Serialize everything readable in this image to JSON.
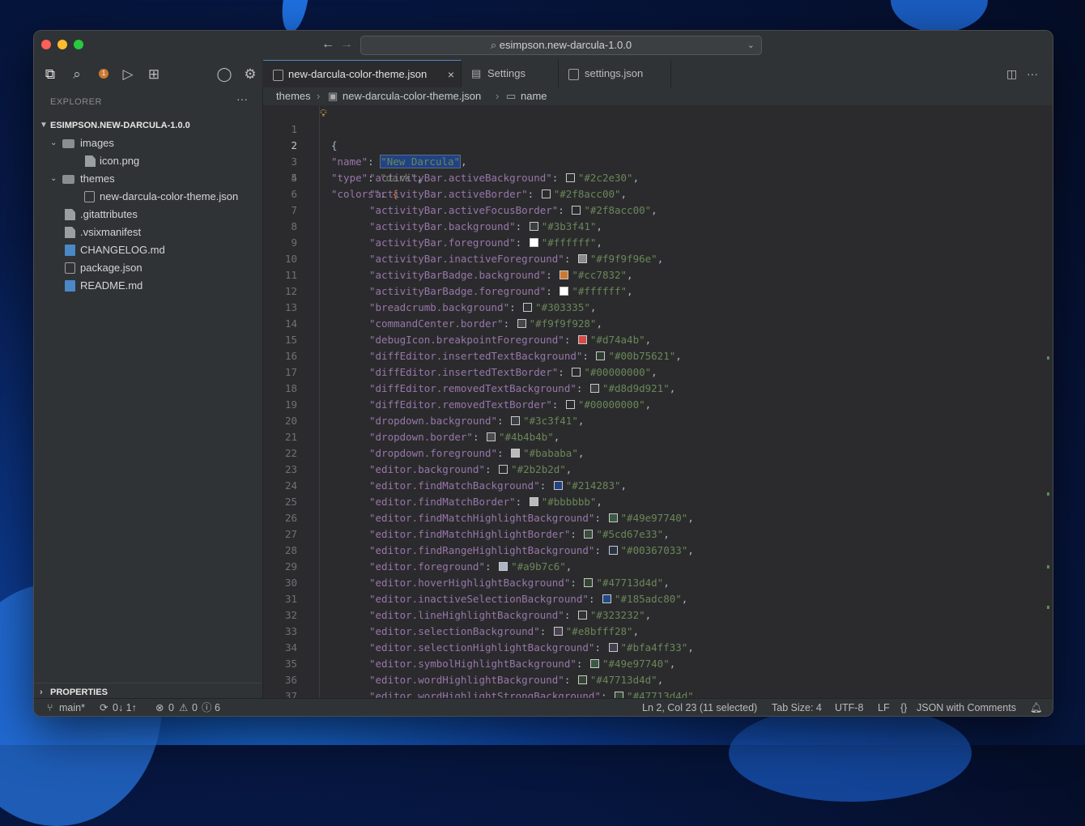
{
  "window": {
    "command_center": "esimpson.new-darcula-1.0.0"
  },
  "sidebar": {
    "title": "EXPLORER",
    "root": "ESIMPSON.NEW-DARCULA-1.0.0",
    "tree": [
      {
        "label": "images",
        "kind": "folder"
      },
      {
        "label": "icon.png",
        "kind": "file"
      },
      {
        "label": "themes",
        "kind": "folder"
      },
      {
        "label": "new-darcula-color-theme.json",
        "kind": "json"
      },
      {
        "label": ".gitattributes",
        "kind": "file"
      },
      {
        "label": ".vsixmanifest",
        "kind": "file"
      },
      {
        "label": "CHANGELOG.md",
        "kind": "md"
      },
      {
        "label": "package.json",
        "kind": "json"
      },
      {
        "label": "README.md",
        "kind": "md"
      }
    ],
    "properties": "PROPERTIES",
    "badge_count": "1"
  },
  "tabs": [
    {
      "label": "new-darcula-color-theme.json",
      "active": true
    },
    {
      "label": "Settings",
      "active": false
    },
    {
      "label": "settings.json",
      "active": false
    }
  ],
  "breadcrumb": [
    "themes",
    "new-darcula-color-theme.json",
    "name"
  ],
  "editor": {
    "header_lines": [
      {
        "n": "1",
        "text": "{"
      },
      {
        "n": "2",
        "key": "\"name\"",
        "value": "\"New Darcula\""
      },
      {
        "n": "3",
        "key": "\"type\"",
        "value": "\"dark\""
      },
      {
        "n": "4",
        "key": "\"colors\"",
        "value": "{"
      }
    ],
    "color_lines": [
      {
        "n": "5",
        "key": "\"activityBar.activeBackground\"",
        "value": "\"#2c2e30\"",
        "swatch": "#2c2e30"
      },
      {
        "n": "6",
        "key": "\"activityBar.activeBorder\"",
        "value": "\"#2f8acc00\"",
        "swatch": "#2b2b2d"
      },
      {
        "n": "7",
        "key": "\"activityBar.activeFocusBorder\"",
        "value": "\"#2f8acc00\"",
        "swatch": "#2b2b2d"
      },
      {
        "n": "8",
        "key": "\"activityBar.background\"",
        "value": "\"#3b3f41\"",
        "swatch": "#3b3f41"
      },
      {
        "n": "9",
        "key": "\"activityBar.foreground\"",
        "value": "\"#ffffff\"",
        "swatch": "#ffffff"
      },
      {
        "n": "10",
        "key": "\"activityBar.inactiveForeground\"",
        "value": "\"#f9f9f96e\"",
        "swatch": "#8a8a8a"
      },
      {
        "n": "11",
        "key": "\"activityBarBadge.background\"",
        "value": "\"#cc7832\"",
        "swatch": "#cc7832"
      },
      {
        "n": "12",
        "key": "\"activityBarBadge.foreground\"",
        "value": "\"#ffffff\"",
        "swatch": "#ffffff"
      },
      {
        "n": "13",
        "key": "\"breadcrumb.background\"",
        "value": "\"#303335\"",
        "swatch": "#303335"
      },
      {
        "n": "14",
        "key": "\"commandCenter.border\"",
        "value": "\"#f9f9f928\"",
        "swatch": "#45474a"
      },
      {
        "n": "15",
        "key": "\"debugIcon.breakpointForeground\"",
        "value": "\"#d74a4b\"",
        "swatch": "#d74a4b"
      },
      {
        "n": "16",
        "key": "\"diffEditor.insertedTextBackground\"",
        "value": "\"#00b75621\"",
        "swatch": "#2b3d31"
      },
      {
        "n": "17",
        "key": "\"diffEditor.insertedTextBorder\"",
        "value": "\"#00000000\"",
        "swatch": "#2b2b2d"
      },
      {
        "n": "18",
        "key": "\"diffEditor.removedTextBackground\"",
        "value": "\"#d8d9d921\"",
        "swatch": "#3d3e40"
      },
      {
        "n": "19",
        "key": "\"diffEditor.removedTextBorder\"",
        "value": "\"#00000000\"",
        "swatch": "#2b2b2d"
      },
      {
        "n": "20",
        "key": "\"dropdown.background\"",
        "value": "\"#3c3f41\"",
        "swatch": "#3c3f41"
      },
      {
        "n": "21",
        "key": "\"dropdown.border\"",
        "value": "\"#4b4b4b\"",
        "swatch": "#4b4b4b"
      },
      {
        "n": "22",
        "key": "\"dropdown.foreground\"",
        "value": "\"#bababa\"",
        "swatch": "#bababa"
      },
      {
        "n": "23",
        "key": "\"editor.background\"",
        "value": "\"#2b2b2d\"",
        "swatch": "#2b2b2d"
      },
      {
        "n": "24",
        "key": "\"editor.findMatchBackground\"",
        "value": "\"#214283\"",
        "swatch": "#214283"
      },
      {
        "n": "25",
        "key": "\"editor.findMatchBorder\"",
        "value": "\"#bbbbbb\"",
        "swatch": "#bbbbbb"
      },
      {
        "n": "26",
        "key": "\"editor.findMatchHighlightBackground\"",
        "value": "\"#49e97740\"",
        "swatch": "#3b5a43"
      },
      {
        "n": "27",
        "key": "\"editor.findMatchHighlightBorder\"",
        "value": "\"#5cd67e33\"",
        "swatch": "#3a4d3f"
      },
      {
        "n": "28",
        "key": "\"editor.findRangeHighlightBackground\"",
        "value": "\"#00367033\"",
        "swatch": "#283447"
      },
      {
        "n": "29",
        "key": "\"editor.foreground\"",
        "value": "\"#a9b7c6\"",
        "swatch": "#a9b7c6"
      },
      {
        "n": "30",
        "key": "\"editor.hoverHighlightBackground\"",
        "value": "\"#47713d4d\"",
        "swatch": "#334531"
      },
      {
        "n": "31",
        "key": "\"editor.inactiveSelectionBackground\"",
        "value": "\"#185adc80\"",
        "swatch": "#224a8a"
      },
      {
        "n": "32",
        "key": "\"editor.lineHighlightBackground\"",
        "value": "\"#323232\"",
        "swatch": "#323232"
      },
      {
        "n": "33",
        "key": "\"editor.selectionBackground\"",
        "value": "\"#e8bfff28\"",
        "swatch": "#4a434f"
      },
      {
        "n": "34",
        "key": "\"editor.selectionHighlightBackground\"",
        "value": "\"#bfa4ff33\"",
        "swatch": "#45404f"
      },
      {
        "n": "35",
        "key": "\"editor.symbolHighlightBackground\"",
        "value": "\"#49e97740\"",
        "swatch": "#3b5a43"
      },
      {
        "n": "36",
        "key": "\"editor.wordHighlightBackground\"",
        "value": "\"#47713d4d\"",
        "swatch": "#334531"
      },
      {
        "n": "37",
        "key": "\"editor.wordHighlightStrongBackground\"",
        "value": "\"#47713d4d\"",
        "swatch": "#334531"
      }
    ]
  },
  "statusbar": {
    "branch": "main*",
    "sync": "0↓ 1↑",
    "errors": "0",
    "warnings": "0",
    "infos": "6",
    "position": "Ln 2, Col 23 (11 selected)",
    "tab_size": "Tab Size: 4",
    "encoding": "UTF-8",
    "eol": "LF",
    "language": "JSON with Comments"
  },
  "colors": {
    "accent": "#4a88c7",
    "badge": "#cc7832",
    "key": "#9876aa",
    "string": "#6a8759"
  }
}
